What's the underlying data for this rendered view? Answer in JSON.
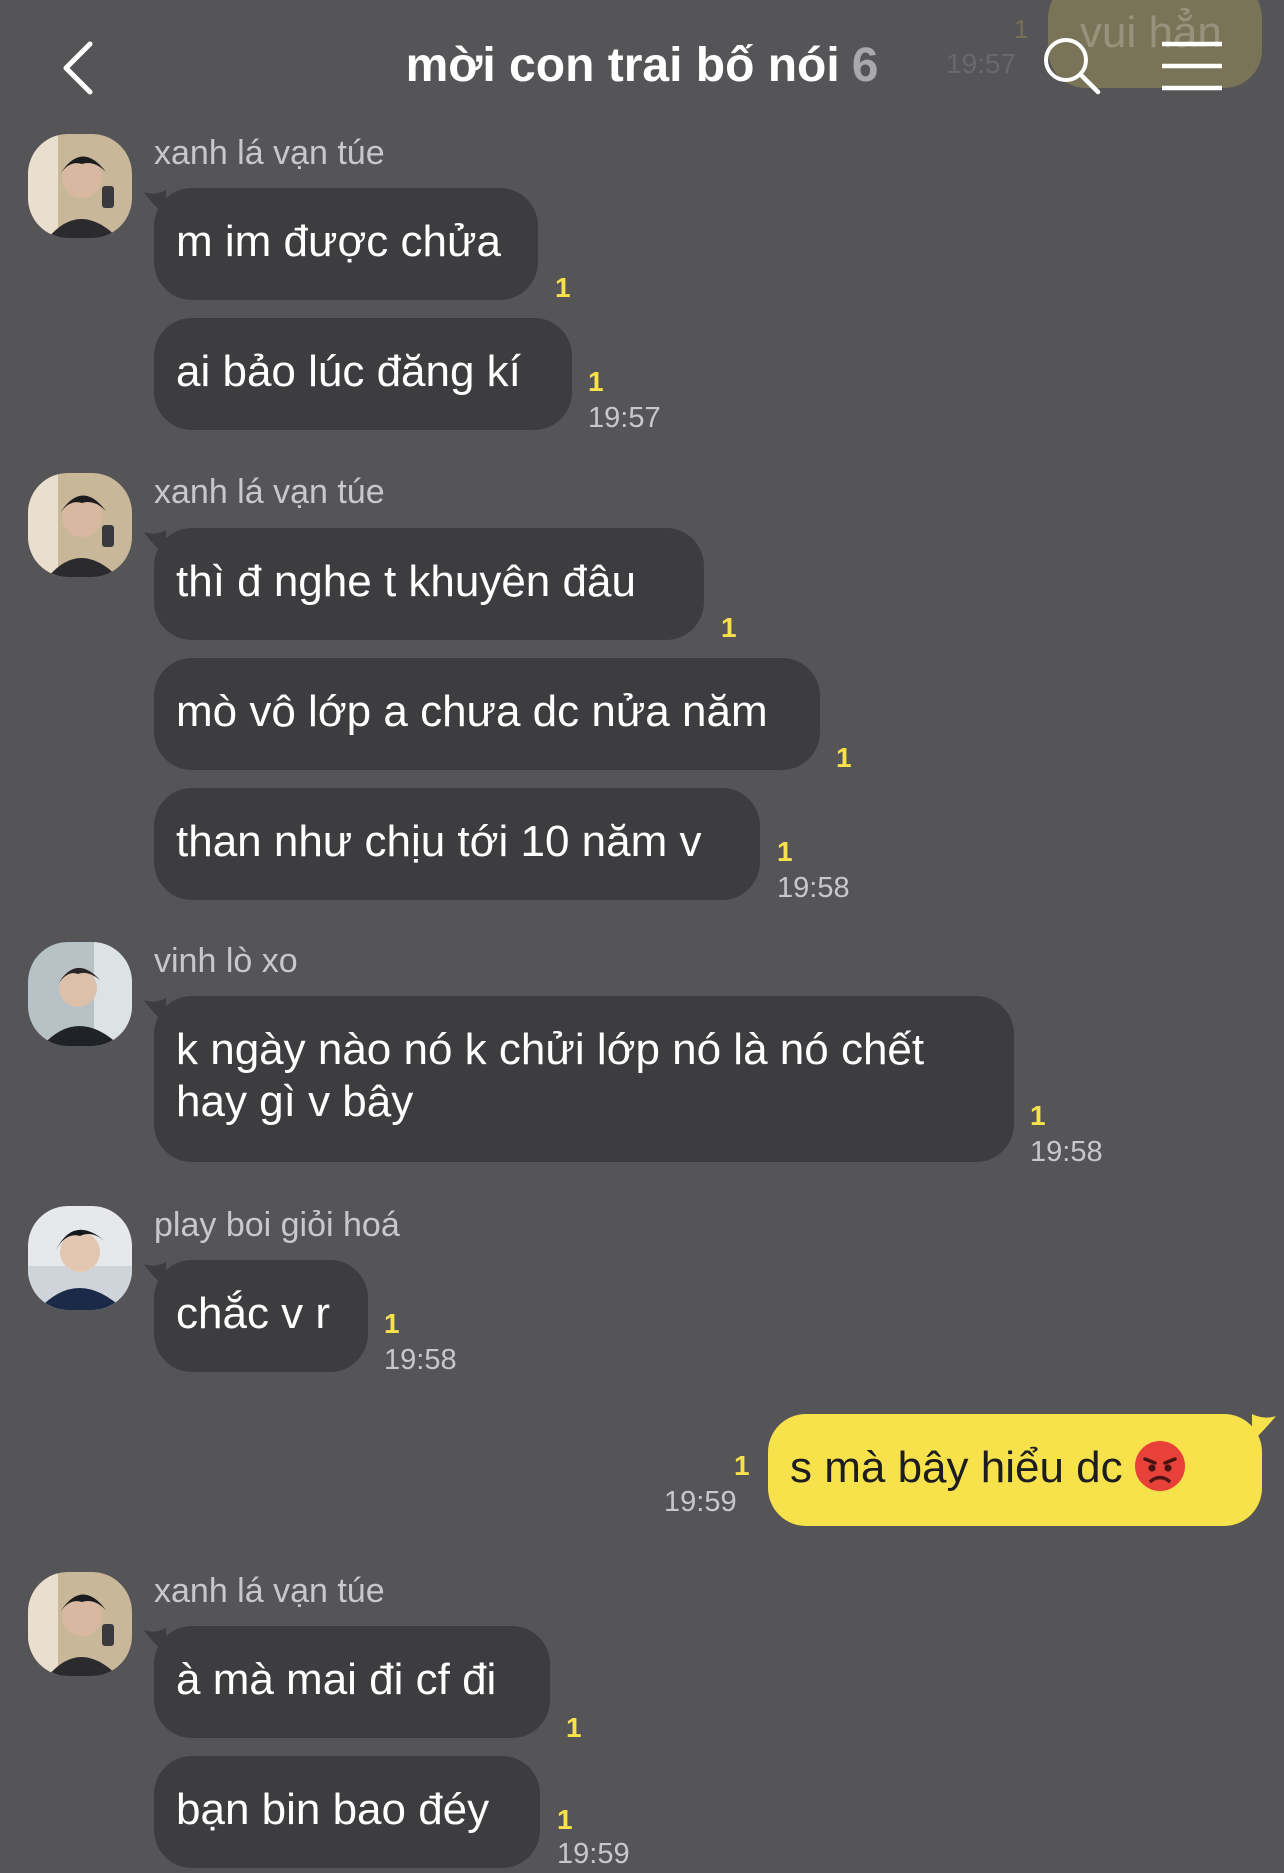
{
  "header": {
    "title": "mời con trai bố nói",
    "member_count": "6",
    "back_icon": "chevron-left-icon",
    "search_icon": "search-icon",
    "menu_icon": "hamburger-menu-icon"
  },
  "ghost_message": {
    "text": "vui hẳn",
    "read_count": "1",
    "time": "19:57"
  },
  "colors": {
    "background": "#555457",
    "incoming_bubble": "#3d3d40",
    "outgoing_bubble": "#f7e24b",
    "read_indicator": "#f7e24b"
  },
  "messages": [
    {
      "type": "sender",
      "name": "xanh lá vạn túe",
      "avatar": "avatar-xanh"
    },
    {
      "type": "in",
      "text": "m im được chửa",
      "read": "1",
      "time": ""
    },
    {
      "type": "in",
      "text": "ai bảo lúc đăng kí",
      "read": "1",
      "time": "19:57"
    },
    {
      "type": "sender",
      "name": "xanh lá vạn túe",
      "avatar": "avatar-xanh"
    },
    {
      "type": "in",
      "text": "thì đ nghe t khuyên đâu",
      "read": "1",
      "time": ""
    },
    {
      "type": "in",
      "text": "mò vô lớp a chưa dc nửa năm",
      "read": "1",
      "time": ""
    },
    {
      "type": "in",
      "text": "than như chịu tới 10 năm v",
      "read": "1",
      "time": "19:58"
    },
    {
      "type": "sender",
      "name": "vinh lò xo",
      "avatar": "avatar-vinh"
    },
    {
      "type": "in",
      "lines": [
        "k ngày nào nó k chửi lớp nó là nó chết",
        "hay gì v bây"
      ],
      "read": "1",
      "time": "19:58"
    },
    {
      "type": "sender",
      "name": "play boi giỏi hoá",
      "avatar": "avatar-play"
    },
    {
      "type": "in",
      "text": "chắc v r",
      "read": "1",
      "time": "19:58"
    },
    {
      "type": "out",
      "text": "s mà bây hiểu dc",
      "emoji": "angry-face-emoji",
      "read": "1",
      "time": "19:59"
    },
    {
      "type": "sender",
      "name": "xanh lá vạn túe",
      "avatar": "avatar-xanh"
    },
    {
      "type": "in",
      "text": "à mà mai đi cf đi",
      "read": "1",
      "time": ""
    },
    {
      "type": "in",
      "text": "bạn bin bao đéy",
      "read": "1",
      "time": "19:59"
    }
  ]
}
